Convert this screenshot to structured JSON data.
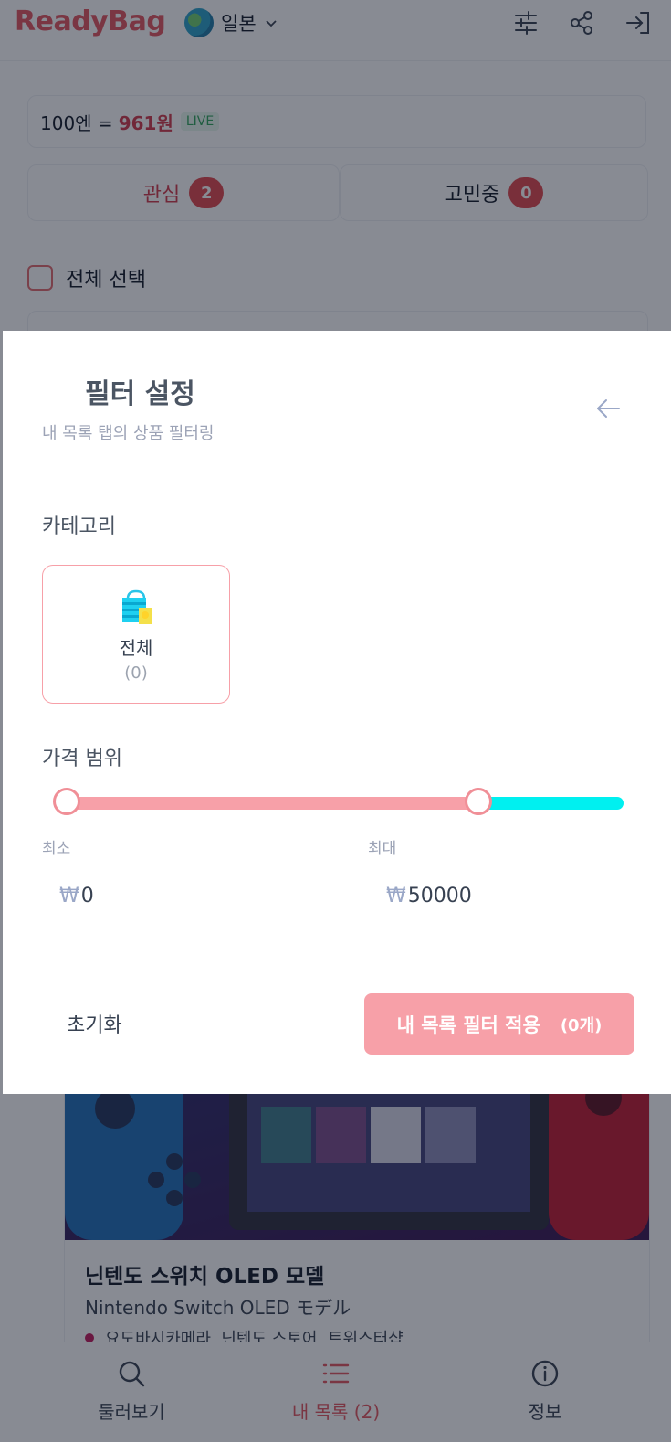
{
  "app": {
    "logo": "ReadyBag",
    "country": "일본"
  },
  "rate": {
    "prefix": "100엔 = ",
    "won": "961원",
    "live": "LIVE"
  },
  "tabs": [
    {
      "label": "관심",
      "count": "2"
    },
    {
      "label": "고민중",
      "count": "0"
    }
  ],
  "select_all": "전체 선택",
  "product": {
    "name": "닌텐도 스위치 OLED 모델",
    "name_jp": "Nintendo Switch OLED モデル",
    "stores": "요도바시카메라, 닌텐도 스토어, 트위스터샵"
  },
  "nav": [
    {
      "label": "둘러보기",
      "icon": "search-icon"
    },
    {
      "label": "내 목록 (2)",
      "icon": "list-icon"
    },
    {
      "label": "정보",
      "icon": "info-icon"
    }
  ],
  "filter": {
    "title": "필터 설정",
    "subtitle": "내 목록 탭의 상품 필터링",
    "category_label": "카테고리",
    "category": {
      "name": "전체",
      "count": "(0)",
      "icon": "shopping-bag-icon"
    },
    "price_label": "가격 범위",
    "min_label": "최소",
    "max_label": "최대",
    "currency": "₩",
    "min_value": "0",
    "max_value": "50000",
    "slider_max_fraction": 0.74,
    "reset": "초기화",
    "apply": "내 목록 필터 적용",
    "apply_count": "(0개)"
  },
  "colors": {
    "brand": "#e2545e",
    "accent_pink": "#f7a0a8",
    "slider_rest": "#00f0f0",
    "badge": "#e0474c"
  }
}
